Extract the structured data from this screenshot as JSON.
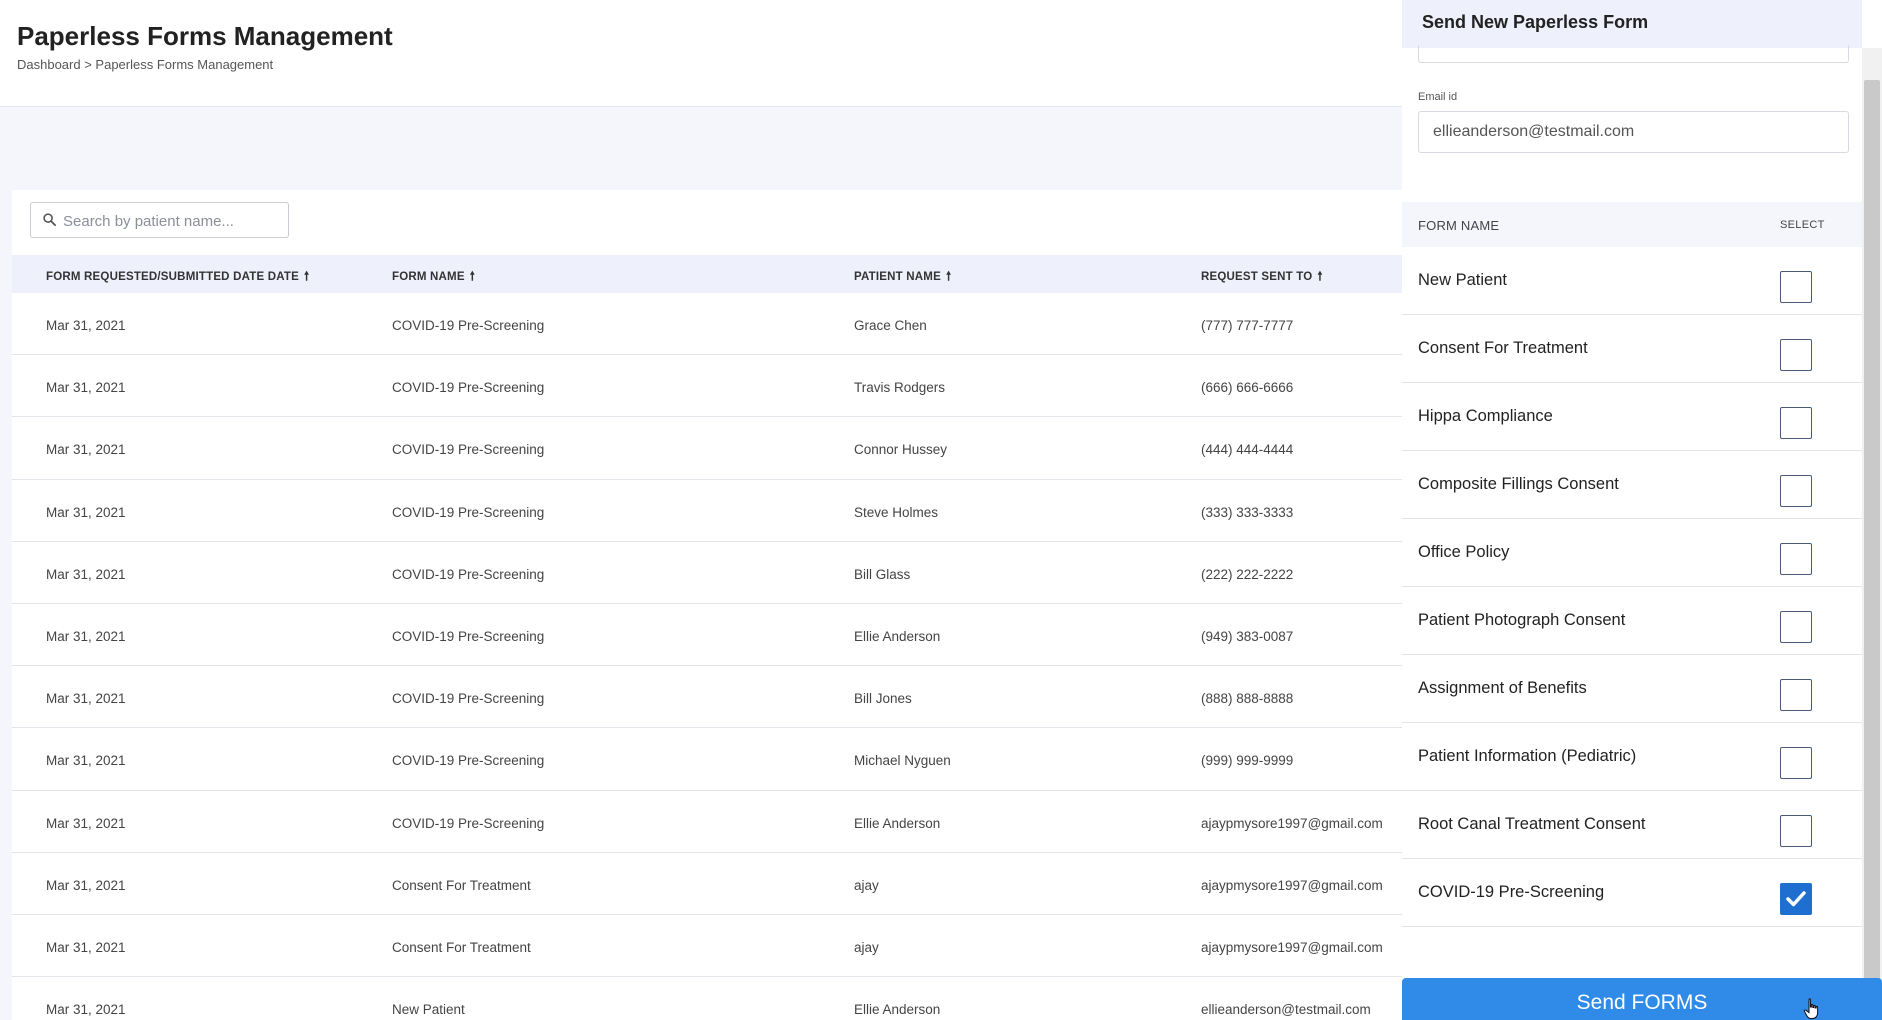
{
  "header": {
    "title": "Paperless Forms Management",
    "breadcrumb": "Dashboard > Paperless Forms Management"
  },
  "search": {
    "placeholder": "Search by patient name..."
  },
  "table": {
    "columns": [
      "FORM REQUESTED/SUBMITTED DATE DATE",
      "FORM NAME",
      "PATIENT NAME",
      "REQUEST SENT TO"
    ],
    "sort_icon": "arrow-up-icon",
    "rows": [
      {
        "date": "Mar 31, 2021",
        "form": "COVID-19 Pre-Screening",
        "patient": "Grace Chen",
        "sent_to": "(777) 777-7777"
      },
      {
        "date": "Mar 31, 2021",
        "form": "COVID-19 Pre-Screening",
        "patient": "Travis Rodgers",
        "sent_to": "(666) 666-6666"
      },
      {
        "date": "Mar 31, 2021",
        "form": "COVID-19 Pre-Screening",
        "patient": "Connor Hussey",
        "sent_to": "(444) 444-4444"
      },
      {
        "date": "Mar 31, 2021",
        "form": "COVID-19 Pre-Screening",
        "patient": "Steve Holmes",
        "sent_to": "(333) 333-3333"
      },
      {
        "date": "Mar 31, 2021",
        "form": "COVID-19 Pre-Screening",
        "patient": "Bill Glass",
        "sent_to": "(222) 222-2222"
      },
      {
        "date": "Mar 31, 2021",
        "form": "COVID-19 Pre-Screening",
        "patient": "Ellie Anderson",
        "sent_to": "(949) 383-0087"
      },
      {
        "date": "Mar 31, 2021",
        "form": "COVID-19 Pre-Screening",
        "patient": "Bill Jones",
        "sent_to": "(888) 888-8888"
      },
      {
        "date": "Mar 31, 2021",
        "form": "COVID-19 Pre-Screening",
        "patient": "Michael Nyguen",
        "sent_to": "(999) 999-9999"
      },
      {
        "date": "Mar 31, 2021",
        "form": "COVID-19 Pre-Screening",
        "patient": "Ellie Anderson",
        "sent_to": "ajaypmysore1997@gmail.com"
      },
      {
        "date": "Mar 31, 2021",
        "form": "Consent For Treatment",
        "patient": "ajay",
        "sent_to": "ajaypmysore1997@gmail.com"
      },
      {
        "date": "Mar 31, 2021",
        "form": "Consent For Treatment",
        "patient": "ajay",
        "sent_to": "ajaypmysore1997@gmail.com"
      },
      {
        "date": "Mar 31, 2021",
        "form": "New Patient",
        "patient": "Ellie Anderson",
        "sent_to": "ellieanderson@testmail.com"
      }
    ]
  },
  "panel": {
    "title": "Send New Paperless Form",
    "email_label": "Email id",
    "email_value": "ellieanderson@testmail.com",
    "form_name_header": "FORM NAME",
    "select_header": "SELECT",
    "forms": [
      {
        "name": "New Patient",
        "checked": false
      },
      {
        "name": "Consent For Treatment",
        "checked": false
      },
      {
        "name": "Hippa Compliance",
        "checked": false
      },
      {
        "name": "Composite Fillings Consent",
        "checked": false
      },
      {
        "name": "Office Policy",
        "checked": false
      },
      {
        "name": "Patient Photograph Consent",
        "checked": false
      },
      {
        "name": "Assignment of Benefits",
        "checked": false
      },
      {
        "name": "Patient Information (Pediatric)",
        "checked": false
      },
      {
        "name": "Root Canal Treatment Consent",
        "checked": false
      },
      {
        "name": "COVID-19 Pre-Screening",
        "checked": true
      }
    ],
    "send_button": "Send FORMS"
  },
  "colors": {
    "accent": "#2f8ae8",
    "checkbox_checked": "#1f6fd1",
    "header_band": "#eef0fb"
  }
}
